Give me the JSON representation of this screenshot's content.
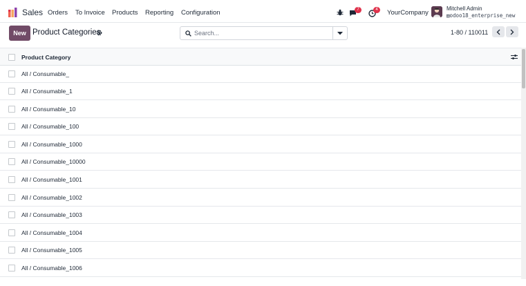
{
  "navbar": {
    "app_name": "Sales",
    "menu": [
      "Orders",
      "To Invoice",
      "Products",
      "Reporting",
      "Configuration"
    ],
    "messages_count": "7",
    "activities_count": "4",
    "company": "YourCompany",
    "user_name": "Mitchell Admin",
    "db_name": "odoo18_enterprise_new",
    "icons": [
      "sales-app-icon",
      "bug-icon",
      "chat-icon",
      "clock-icon",
      "database-icon"
    ]
  },
  "control": {
    "new_label": "New",
    "title": "Product Categories",
    "search_placeholder": "Search...",
    "pager_value": "1-80 / 110011"
  },
  "list": {
    "header": "Product Category",
    "rows": [
      "All / Consumable_",
      "All / Consumable_1",
      "All / Consumable_10",
      "All / Consumable_100",
      "All / Consumable_1000",
      "All / Consumable_10000",
      "All / Consumable_1001",
      "All / Consumable_1002",
      "All / Consumable_1003",
      "All / Consumable_1004",
      "All / Consumable_1005",
      "All / Consumable_1006"
    ]
  },
  "colors": {
    "primary": "#714b67",
    "badge": "#e0334c"
  }
}
